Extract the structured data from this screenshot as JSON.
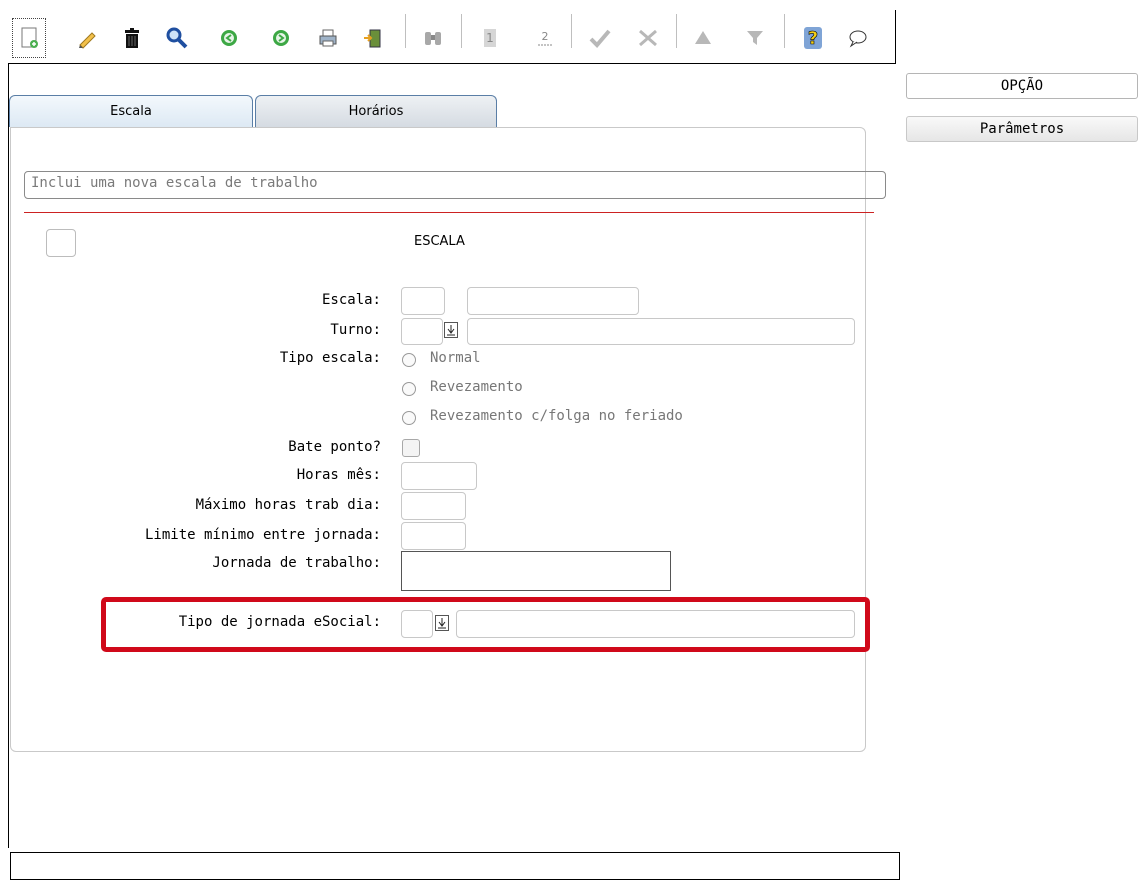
{
  "toolbar": {
    "icons": [
      "new-document-icon",
      "edit-pencil-icon",
      "trash-icon",
      "search-magnifier-icon",
      "arrow-left-circle-icon",
      "arrow-right-circle-icon",
      "printer-icon",
      "exit-door-icon",
      "binoculars-icon",
      "number-one-icon",
      "number-two-icon",
      "check-confirm-icon",
      "cancel-x-icon",
      "triangle-up-icon",
      "filter-funnel-icon",
      "help-question-icon",
      "chat-bubble-icon"
    ]
  },
  "side": {
    "option_label": "OPÇÃO",
    "params_label": "Parâmetros"
  },
  "tabs": [
    {
      "label": "Escala"
    },
    {
      "label": "Horários"
    }
  ],
  "description": "Inclui uma nova escala de trabalho",
  "section_title": "ESCALA",
  "form": {
    "escala_label": "Escala:",
    "turno_label": "Turno:",
    "tipo_escala_label": "Tipo escala:",
    "tipo_escala_options": [
      "Normal",
      "Revezamento",
      "Revezamento c/folga no feriado"
    ],
    "bate_ponto_label": "Bate ponto?",
    "horas_mes_label": "Horas mês:",
    "max_horas_label": "Máximo horas trab dia:",
    "limite_label": "Limite mínimo entre jornada:",
    "jornada_label": "Jornada de trabalho:",
    "tipo_jornada_label": "Tipo de jornada eSocial:"
  },
  "colors": {
    "highlight": "#d0091a",
    "divider": "#cc2222",
    "tab_border": "#5a7ea6"
  }
}
